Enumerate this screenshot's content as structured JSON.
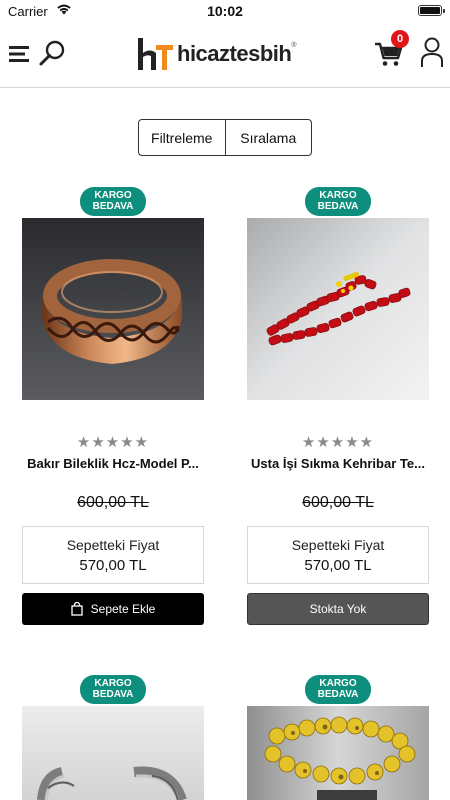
{
  "status_bar": {
    "carrier": "Carrier",
    "time": "10:02"
  },
  "header": {
    "logo_text": "hicaztesbih",
    "logo_registered": "®",
    "cart_count": "0",
    "icons": [
      "menu-icon",
      "search-icon",
      "cart-icon",
      "user-icon"
    ]
  },
  "filter_bar": {
    "filter_label": "Filtreleme",
    "sort_label": "Sıralama"
  },
  "products": [
    {
      "badge": "KARGO BEDAVA",
      "rating_stars": "★★★★★",
      "rating_value": 0,
      "name": "Bakır Bileklik Hcz-Model P...",
      "old_price": "600,00 TL",
      "basket_label": "Sepetteki Fiyat",
      "basket_price": "570,00 TL",
      "cta": "Sepete Ekle",
      "in_stock": true
    },
    {
      "badge": "KARGO BEDAVA",
      "rating_stars": "★★★★★",
      "rating_value": 0,
      "name": "Usta İşi Sıkma Kehribar Te...",
      "old_price": "600,00 TL",
      "basket_label": "Sepetteki Fiyat",
      "basket_price": "570,00 TL",
      "cta": "Stokta Yok",
      "in_stock": false
    },
    {
      "badge": "KARGO BEDAVA"
    },
    {
      "badge": "KARGO BEDAVA"
    }
  ],
  "colors": {
    "badge_green": "#0e8f7e",
    "cart_badge_red": "#e0161b",
    "cta_black": "#000000",
    "cta_disabled": "#555555",
    "rating_gray": "#8a8a8a"
  }
}
